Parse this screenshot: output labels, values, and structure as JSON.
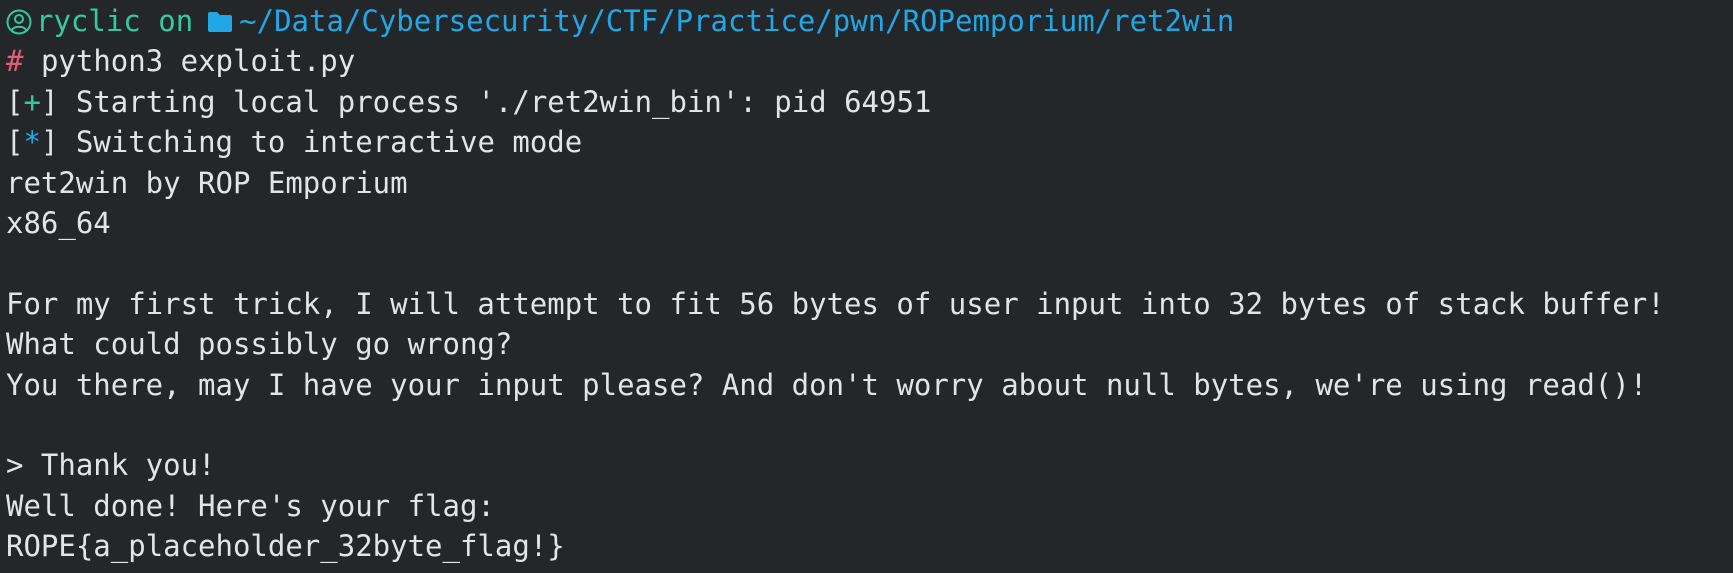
{
  "prompt": {
    "user": "ryclic",
    "on": "on",
    "path": "~/Data/Cybersecurity/CTF/Practice/pwn/ROPemporium/ret2win",
    "symbol": "#",
    "command": "python3 exploit.py",
    "colors": {
      "user": "#35c8a3",
      "path": "#22a7e6",
      "symbol": "#e55c7a"
    },
    "icons": [
      "user-circle-icon",
      "folder-icon"
    ]
  },
  "output": {
    "status1": {
      "open": "[",
      "mark": "+",
      "close": "]",
      "text": "Starting local process './ret2win_bin': pid 64951"
    },
    "status2": {
      "open": "[",
      "mark": "*",
      "close": "]",
      "text": "Switching to interactive mode"
    },
    "lines": [
      "ret2win by ROP Emporium",
      "x86_64",
      "",
      "For my first trick, I will attempt to fit 56 bytes of user input into 32 bytes of stack buffer!",
      "What could possibly go wrong?",
      "You there, may I have your input please? And don't worry about null bytes, we're using read()!",
      "",
      "> Thank you!",
      "Well done! Here's your flag:",
      "ROPE{a_placeholder_32byte_flag!}"
    ]
  }
}
